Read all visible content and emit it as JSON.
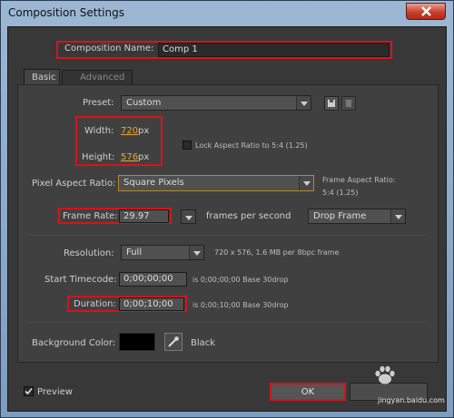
{
  "window": {
    "title": "Composition Settings"
  },
  "comp_name": {
    "label": "Composition Name:",
    "value": "Comp 1"
  },
  "tabs": [
    {
      "label": "Basic"
    },
    {
      "label": "Advanced"
    }
  ],
  "preset": {
    "label": "Preset:",
    "value": "Custom"
  },
  "width": {
    "label": "Width:",
    "value": "720",
    "unit": "px"
  },
  "height": {
    "label": "Height:",
    "value": "576",
    "unit": "px"
  },
  "lock_aspect": {
    "label": "Lock Aspect Ratio to 5:4 (1.25)",
    "checked": false
  },
  "pixel_aspect": {
    "label": "Pixel Aspect Ratio:",
    "value": "Square Pixels",
    "frame_aspect_label": "Frame Aspect Ratio:",
    "frame_aspect_value": "5:4 (1.25)"
  },
  "frame_rate": {
    "label": "Frame Rate:",
    "value": "29.97",
    "unit": "frames per second",
    "drop_mode": "Drop Frame"
  },
  "resolution": {
    "label": "Resolution:",
    "value": "Full",
    "info": "720 x 576, 1.6 MB per 8bpc frame"
  },
  "start_timecode": {
    "label": "Start Timecode:",
    "value": "0;00;00;00",
    "info": "is 0;00;00;00  Base 30drop"
  },
  "duration": {
    "label": "Duration:",
    "value": "0;00;10;00",
    "info": "is 0;00;10;00  Base 30drop"
  },
  "background": {
    "label": "Background Color:",
    "color": "#000000",
    "name": "Black"
  },
  "preview": {
    "label": "Preview",
    "checked": true
  },
  "buttons": {
    "ok": "OK"
  },
  "watermark": {
    "text": "jingyan.baidu.com"
  }
}
